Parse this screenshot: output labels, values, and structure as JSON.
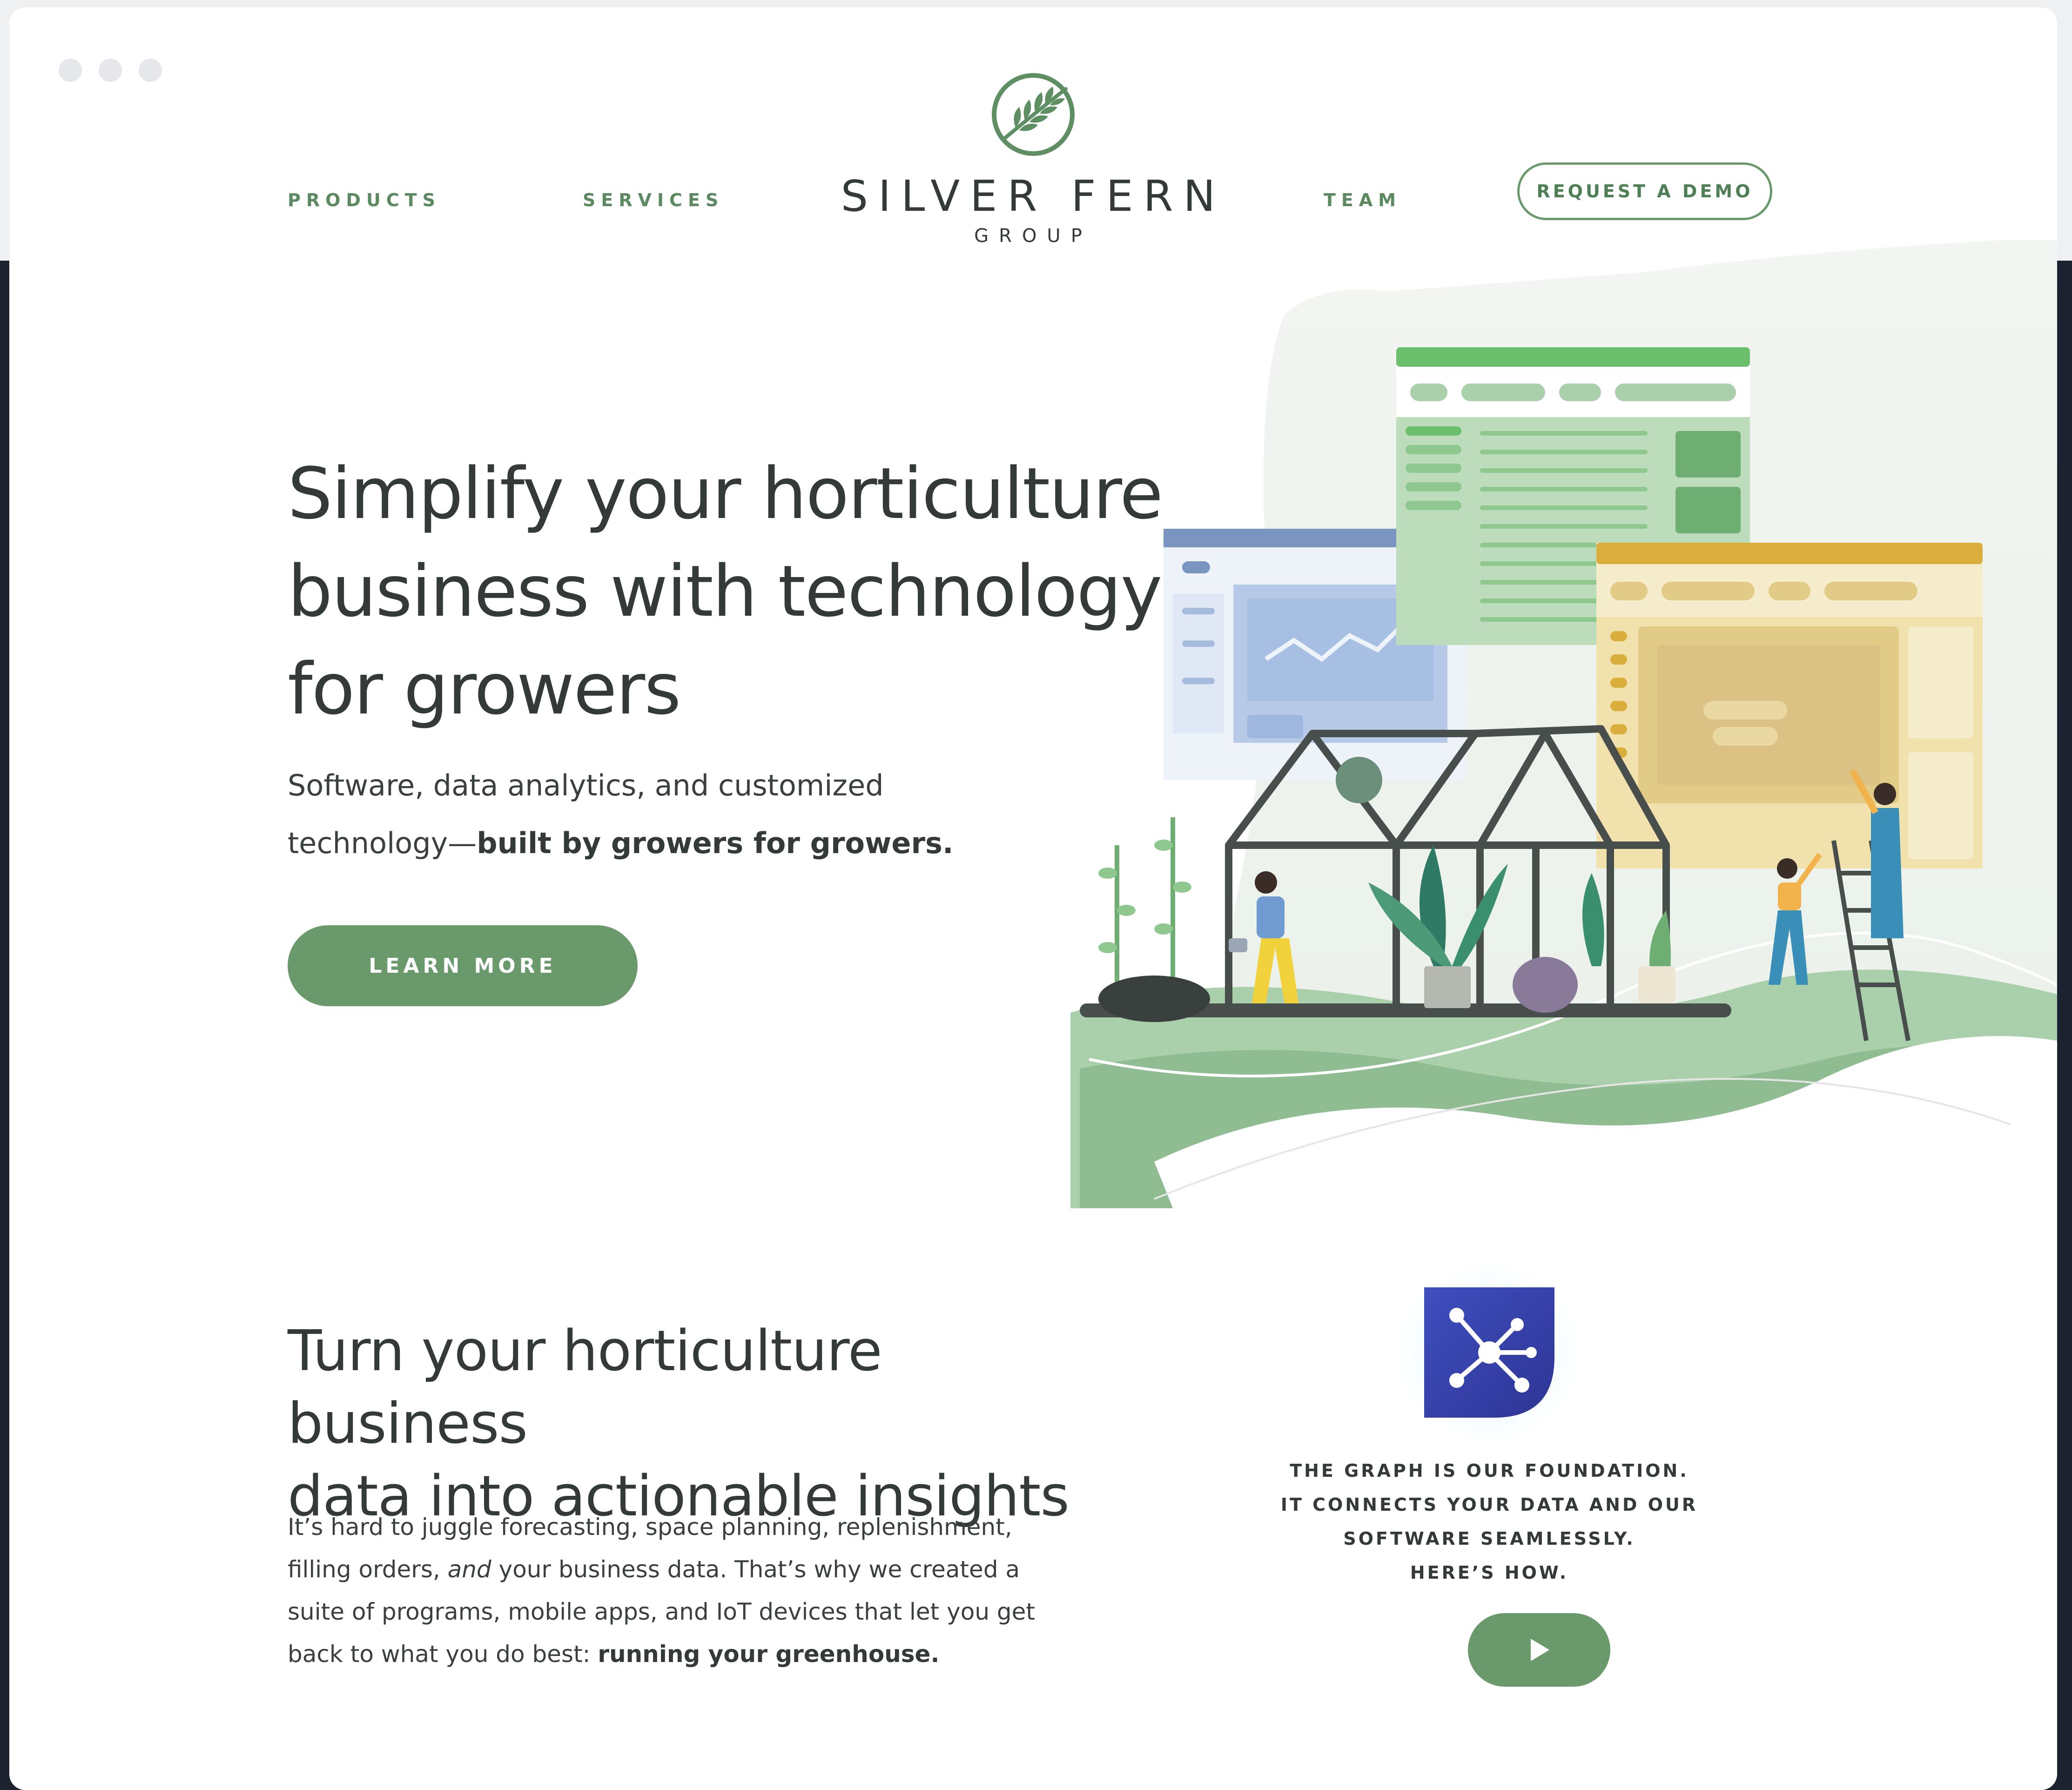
{
  "nav": {
    "products": "PRODUCTS",
    "services": "SERVICES",
    "team": "TEAM",
    "demo": "REQUEST A DEMO"
  },
  "logo": {
    "name": "SILVER FERN",
    "sub": "GROUP",
    "icon": "fern-leaf-icon"
  },
  "hero": {
    "title_lines": [
      "Simplify your horticulture",
      "business with technology",
      "for growers"
    ],
    "subtitle_plain": "Software, data analytics, and customized technology—",
    "subtitle_bold": "built by growers for growers.",
    "cta": "LEARN MORE"
  },
  "section": {
    "title_lines": [
      "Turn your horticulture business",
      "data into actionable insights"
    ],
    "body_1": "It’s hard to juggle forecasting, space planning, replenishment, filling orders, ",
    "body_em": "and",
    "body_2": " your business data. That’s why we created a suite of programs, mobile apps, and IoT devices that let you get back to what you do best: ",
    "body_bold": "running your greenhouse.",
    "caption_lines": [
      "THE GRAPH IS OUR FOUNDATION.",
      "IT CONNECTS YOUR DATA AND OUR",
      "SOFTWARE SEAMLESSLY.",
      "HERE’S HOW."
    ],
    "play_icon": "play-icon",
    "graph_icon": "network-graph-icon"
  },
  "colors": {
    "brand_green": "#6a9a6c",
    "text_dark": "#333a38",
    "graph_blue": "#3a44b0",
    "dashboard_green": "#6cbf6c",
    "dashboard_gold": "#d9ae3c",
    "dashboard_blue": "#7a95c0"
  }
}
